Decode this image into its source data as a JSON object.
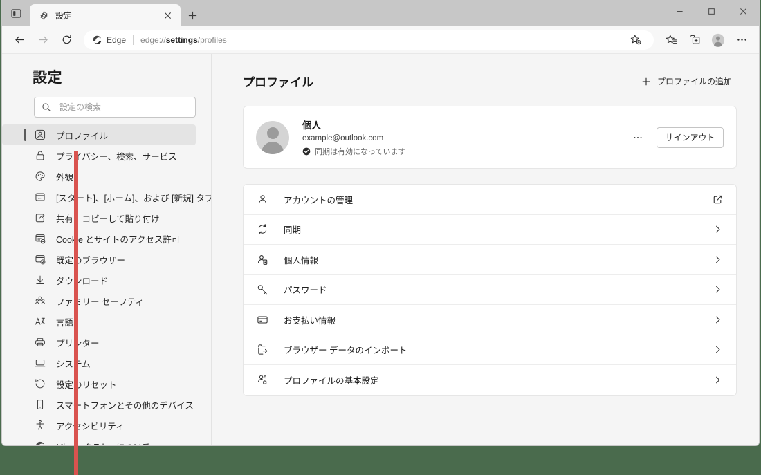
{
  "window": {
    "controls": [
      {
        "name": "minimize",
        "glyph": "minimize-icon"
      },
      {
        "name": "maximize",
        "glyph": "maximize-icon"
      },
      {
        "name": "close",
        "glyph": "close-icon"
      }
    ]
  },
  "tabstrip": {
    "sidebar_toggle_icon": "tab-actions-icon",
    "tab": {
      "favicon": "gear-icon",
      "title": "設定",
      "close_icon": "close-icon"
    },
    "new_tab_icon": "plus-icon"
  },
  "toolbar": {
    "back_icon": "arrow-left-icon",
    "forward_icon": "arrow-right-icon",
    "refresh_icon": "refresh-icon",
    "omnibox": {
      "edge_badge_label": "Edge",
      "url_prefix": "edge://",
      "url_bold": "settings",
      "url_suffix": "/profiles",
      "full_url": "edge://settings/profiles",
      "favorite_icon": "star-add-icon"
    },
    "right_buttons": [
      {
        "name": "favorites",
        "icon": "star-list-icon"
      },
      {
        "name": "collections",
        "icon": "collections-icon"
      },
      {
        "name": "profile",
        "icon": "avatar-icon"
      },
      {
        "name": "settings-and-more",
        "icon": "ellipsis-icon"
      }
    ]
  },
  "sidebar": {
    "title": "設定",
    "search": {
      "icon": "search-icon",
      "placeholder": "設定の検索",
      "value": ""
    },
    "items": [
      {
        "label": "プロファイル",
        "icon": "profile-icon",
        "selected": true
      },
      {
        "label": "プライバシー、検索、サービス",
        "icon": "lock-icon",
        "selected": false
      },
      {
        "label": "外観",
        "icon": "palette-icon",
        "selected": false
      },
      {
        "label": "[スタート]、[ホーム]、および [新規] タブ",
        "icon": "newtab-icon",
        "selected": false
      },
      {
        "label": "共有、コピーして貼り付け",
        "icon": "share-icon",
        "selected": false
      },
      {
        "label": "Cookie とサイトのアクセス許可",
        "icon": "cookie-permissions-icon",
        "selected": false
      },
      {
        "label": "既定のブラウザー",
        "icon": "default-browser-icon",
        "selected": false
      },
      {
        "label": "ダウンロード",
        "icon": "download-icon",
        "selected": false
      },
      {
        "label": "ファミリー セーフティ",
        "icon": "family-safety-icon",
        "selected": false
      },
      {
        "label": "言語",
        "icon": "language-icon",
        "selected": false
      },
      {
        "label": "プリンター",
        "icon": "printer-icon",
        "selected": false
      },
      {
        "label": "システム",
        "icon": "system-icon",
        "selected": false
      },
      {
        "label": "設定のリセット",
        "icon": "reset-icon",
        "selected": false
      },
      {
        "label": "スマートフォンとその他のデバイス",
        "icon": "phone-icon",
        "selected": false
      },
      {
        "label": "アクセシビリティ",
        "icon": "accessibility-icon",
        "selected": false
      },
      {
        "label": "Microsoft Edge について",
        "icon": "edge-logo-icon",
        "selected": false
      }
    ]
  },
  "main": {
    "title": "プロファイル",
    "add_profile": {
      "icon": "plus-icon",
      "label": "プロファイルの追加"
    },
    "profile_card": {
      "avatar_icon": "avatar-icon",
      "name": "個人",
      "email": "example@outlook.com",
      "sync_icon": "sync-check-icon",
      "sync_status": "同期は有効になっています",
      "more_icon": "ellipsis-icon",
      "signout_label": "サインアウト"
    },
    "settings_rows": [
      {
        "label": "アカウントの管理",
        "icon": "person-icon",
        "trailing": "external-link-icon"
      },
      {
        "label": "同期",
        "icon": "sync-icon",
        "trailing": "chevron-right-icon"
      },
      {
        "label": "個人情報",
        "icon": "person-info-icon",
        "trailing": "chevron-right-icon"
      },
      {
        "label": "パスワード",
        "icon": "key-icon",
        "trailing": "chevron-right-icon"
      },
      {
        "label": "お支払い情報",
        "icon": "card-icon",
        "trailing": "chevron-right-icon"
      },
      {
        "label": "ブラウザー データのインポート",
        "icon": "import-icon",
        "trailing": "chevron-right-icon"
      },
      {
        "label": "プロファイルの基本設定",
        "icon": "profile-prefs-icon",
        "trailing": "chevron-right-icon"
      }
    ]
  },
  "annotation": {
    "line_color": "#d9534f",
    "name": "red-vertical-guide-line"
  },
  "colors": {
    "desktop": "#4a6b4d",
    "tabstrip": "#c7c7c7",
    "toolbar": "#f7f7f7",
    "page_bg": "#f5f5f5",
    "card_bg": "#ffffff",
    "selected_nav": "#e4e4e4"
  }
}
